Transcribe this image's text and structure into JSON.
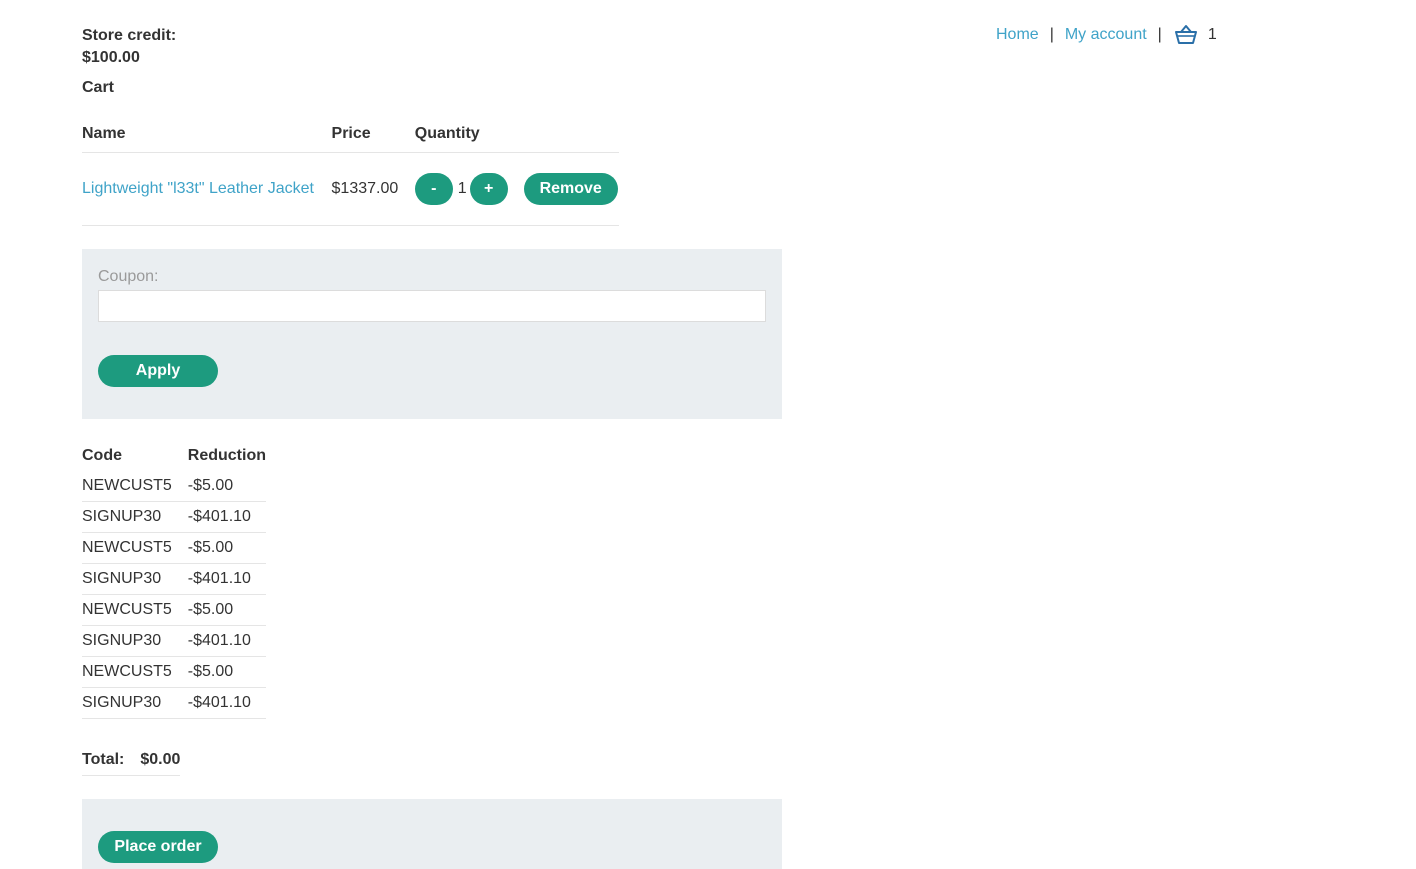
{
  "store_credit": {
    "label": "Store credit:",
    "amount": "$100.00"
  },
  "nav": {
    "home": "Home",
    "separator_1": "|",
    "my_account": "My account",
    "separator_2": "|",
    "cart_icon": "basket-icon",
    "cart_count": "1"
  },
  "cart": {
    "heading": "Cart",
    "columns": [
      "Name",
      "Price",
      "Quantity"
    ],
    "items": [
      {
        "name": "Lightweight \"l33t\" Leather Jacket",
        "price": "$1337.00",
        "quantity": "1",
        "decrement_label": "-",
        "increment_label": "+",
        "remove_label": "Remove"
      }
    ]
  },
  "coupon": {
    "label": "Coupon:",
    "value": "",
    "placeholder": "",
    "apply_label": "Apply"
  },
  "applied_coupons": {
    "columns": [
      "Code",
      "Reduction"
    ],
    "rows": [
      {
        "code": "NEWCUST5",
        "reduction": "-$5.00"
      },
      {
        "code": "SIGNUP30",
        "reduction": "-$401.10"
      },
      {
        "code": "NEWCUST5",
        "reduction": "-$5.00"
      },
      {
        "code": "SIGNUP30",
        "reduction": "-$401.10"
      },
      {
        "code": "NEWCUST5",
        "reduction": "-$5.00"
      },
      {
        "code": "SIGNUP30",
        "reduction": "-$401.10"
      },
      {
        "code": "NEWCUST5",
        "reduction": "-$5.00"
      },
      {
        "code": "SIGNUP30",
        "reduction": "-$401.10"
      }
    ]
  },
  "total": {
    "label": "Total:",
    "amount": "$0.00"
  },
  "order": {
    "place_order_label": "Place order"
  },
  "colors": {
    "accent": "#1d9b7f",
    "link": "#3fa3c8",
    "panel": "#eaeef1"
  }
}
